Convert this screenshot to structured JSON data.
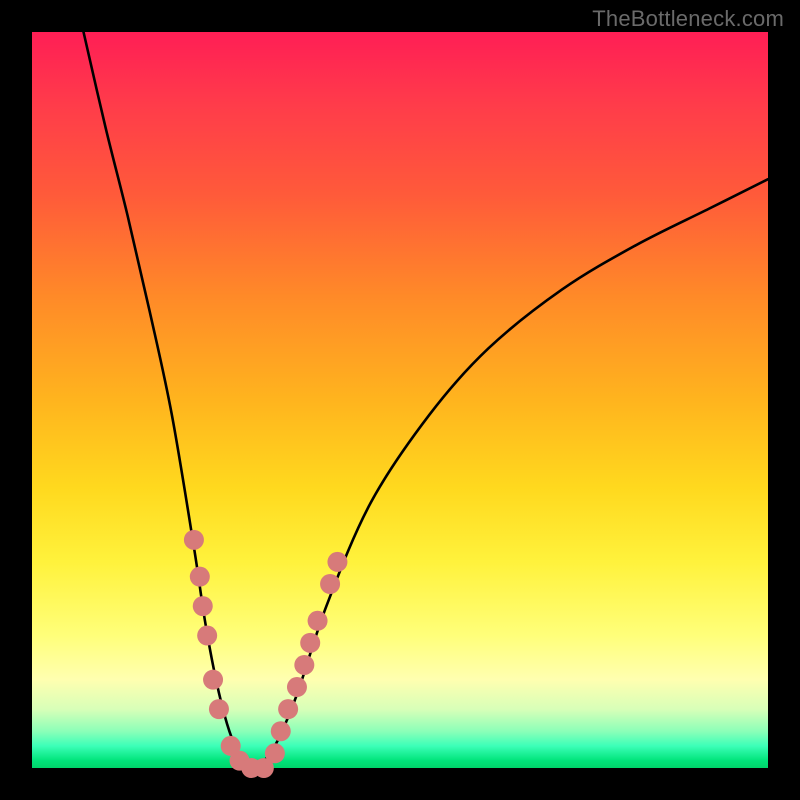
{
  "watermark": "TheBottleneck.com",
  "chart_data": {
    "type": "line",
    "title": "",
    "xlabel": "",
    "ylabel": "",
    "xlim": [
      0,
      100
    ],
    "ylim": [
      0,
      100
    ],
    "grid": false,
    "legend": false,
    "annotations": [],
    "background_gradient_stops": [
      {
        "pos": 0,
        "color": "#ff1e55"
      },
      {
        "pos": 10,
        "color": "#ff3c4a"
      },
      {
        "pos": 22,
        "color": "#ff5a3a"
      },
      {
        "pos": 36,
        "color": "#ff8a28"
      },
      {
        "pos": 50,
        "color": "#ffb41e"
      },
      {
        "pos": 62,
        "color": "#ffd91e"
      },
      {
        "pos": 72,
        "color": "#fff23c"
      },
      {
        "pos": 82,
        "color": "#ffff7a"
      },
      {
        "pos": 88,
        "color": "#ffffb0"
      },
      {
        "pos": 92,
        "color": "#d8ffb8"
      },
      {
        "pos": 95,
        "color": "#8cffb8"
      },
      {
        "pos": 97,
        "color": "#3cffb8"
      },
      {
        "pos": 99,
        "color": "#00e47a"
      },
      {
        "pos": 100,
        "color": "#00d46a"
      }
    ],
    "series": [
      {
        "name": "bottleneck-curve",
        "color": "#000000",
        "x": [
          7,
          10,
          13,
          16,
          19,
          22,
          23.5,
          25,
          26.5,
          28,
          29,
          30,
          31,
          33,
          36,
          40,
          46,
          54,
          62,
          72,
          82,
          92,
          100
        ],
        "y": [
          100,
          87,
          75,
          62,
          48,
          30,
          20,
          12,
          6,
          2,
          0.5,
          0,
          0.5,
          3,
          10,
          22,
          36,
          48,
          57,
          65,
          71,
          76,
          80
        ]
      }
    ],
    "valley_floor": {
      "x_start": 29,
      "x_end": 31,
      "y": 0
    },
    "markers": {
      "name": "sample-points",
      "color": "#d77a7a",
      "radius": 10,
      "points": [
        {
          "x": 22.0,
          "y": 31
        },
        {
          "x": 22.8,
          "y": 26
        },
        {
          "x": 23.2,
          "y": 22
        },
        {
          "x": 23.8,
          "y": 18
        },
        {
          "x": 24.6,
          "y": 12
        },
        {
          "x": 25.4,
          "y": 8
        },
        {
          "x": 27.0,
          "y": 3
        },
        {
          "x": 28.2,
          "y": 1
        },
        {
          "x": 29.8,
          "y": 0
        },
        {
          "x": 31.5,
          "y": 0
        },
        {
          "x": 33.0,
          "y": 2
        },
        {
          "x": 33.8,
          "y": 5
        },
        {
          "x": 34.8,
          "y": 8
        },
        {
          "x": 36.0,
          "y": 11
        },
        {
          "x": 37.0,
          "y": 14
        },
        {
          "x": 37.8,
          "y": 17
        },
        {
          "x": 38.8,
          "y": 20
        },
        {
          "x": 40.5,
          "y": 25
        },
        {
          "x": 41.5,
          "y": 28
        }
      ]
    }
  }
}
